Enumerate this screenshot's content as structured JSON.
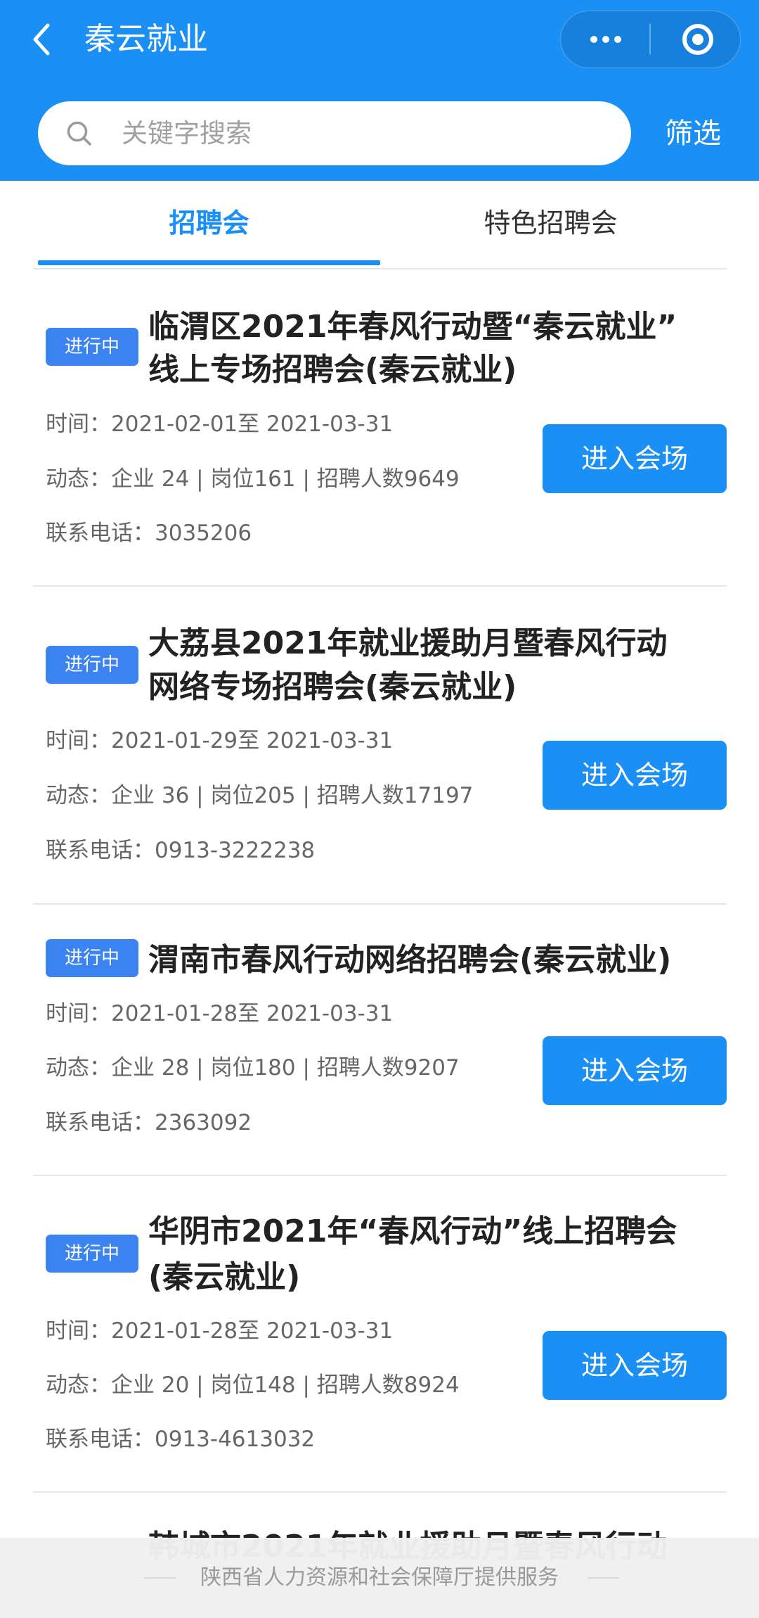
{
  "header": {
    "title": "秦云就业",
    "icons": {
      "back": "chevron-left-icon",
      "more": "more-dots-icon",
      "close": "target-circle-icon"
    }
  },
  "search": {
    "placeholder": "关键字搜索",
    "filter_label": "筛选",
    "icon": "search-icon"
  },
  "tabs": [
    {
      "label": "招聘会",
      "active": true
    },
    {
      "label": "特色招聘会",
      "active": false
    }
  ],
  "cards": [
    {
      "status": "进行中",
      "title_lines": [
        "临渭区2021年春风行动暨“秦云就业”",
        "线上专场招聘会(秦云就业)"
      ],
      "time": "时间：2021-02-01至 2021-03-31",
      "stats": "动态：企业 24 | 岗位161 | 招聘人数9649",
      "phone": "联系电话：3035206",
      "button_label": "进入会场"
    },
    {
      "status": "进行中",
      "title_lines": [
        "大荔县2021年就业援助月暨春风行动",
        "网络专场招聘会(秦云就业)"
      ],
      "time": "时间：2021-01-29至 2021-03-31",
      "stats": "动态：企业 36 | 岗位205 | 招聘人数17197",
      "phone": "联系电话：0913-3222238",
      "button_label": "进入会场"
    },
    {
      "status": "进行中",
      "title_lines": [
        "渭南市春风行动网络招聘会(秦云就业)"
      ],
      "time": "时间：2021-01-28至 2021-03-31",
      "stats": "动态：企业 28 | 岗位180 | 招聘人数9207",
      "phone": "联系电话：2363092",
      "button_label": "进入会场"
    },
    {
      "status": "进行中",
      "title_lines": [
        "华阴市2021年“春风行动”线上招聘会",
        "(秦云就业)"
      ],
      "time": "时间：2021-01-28至 2021-03-31",
      "stats": "动态：企业 20 | 岗位148 | 招聘人数8924",
      "phone": "联系电话：0913-4613032",
      "button_label": "进入会场"
    },
    {
      "title_lines": [
        "韩城市2021年就业援助月暨春风行动"
      ]
    }
  ],
  "footer": {
    "text": "陕西省人力资源和社会保障厅提供服务"
  },
  "colors": {
    "primary": "#1a8ff5",
    "badge": "#3a83f0",
    "title_text": "#222222",
    "info_text": "#666666",
    "footer_bg": "#efefef"
  }
}
